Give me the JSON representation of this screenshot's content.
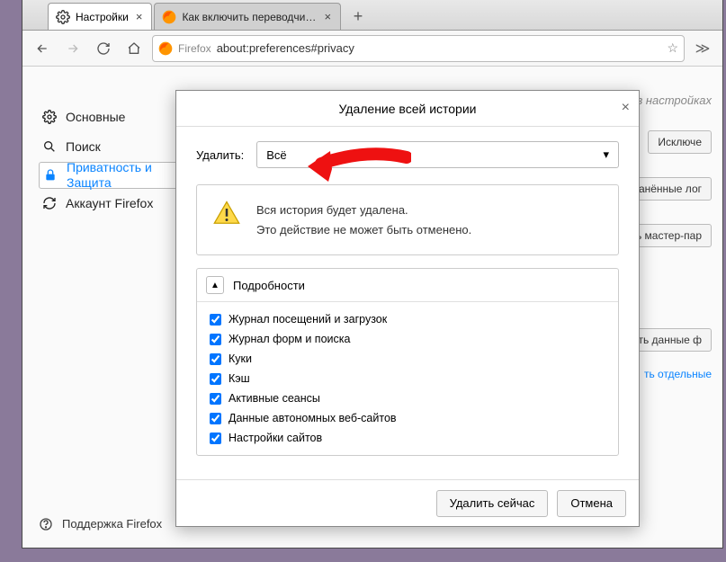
{
  "tabs": [
    {
      "label": "Настройки",
      "active": true
    },
    {
      "label": "Как включить переводчик в M",
      "active": false
    }
  ],
  "url": {
    "brand": "Firefox",
    "address": "about:preferences#privacy"
  },
  "sidebar": {
    "items": [
      {
        "label": "Основные"
      },
      {
        "label": "Поиск"
      },
      {
        "label": "Приватность и Защита"
      },
      {
        "label": "Аккаунт Firefox"
      }
    ],
    "support": "Поддержка Firefox"
  },
  "main": {
    "search_hint": "в настройках",
    "btn_exceptions": "Исключе",
    "btn_saved": "ранённые лог",
    "btn_master": "ь мастер-пар",
    "btn_savedata": "нять данные ф",
    "link_manage": "ть отдельные"
  },
  "dialog": {
    "title": "Удаление всей истории",
    "delete_label": "Удалить:",
    "delete_value": "Всё",
    "warn_line1": "Вся история будет удалена.",
    "warn_line2": "Это действие не может быть отменено.",
    "details_label": "Подробности",
    "items": [
      "Журнал посещений и загрузок",
      "Журнал форм и поиска",
      "Куки",
      "Кэш",
      "Активные сеансы",
      "Данные автономных веб-сайтов",
      "Настройки сайтов"
    ],
    "btn_ok": "Удалить сейчас",
    "btn_cancel": "Отмена"
  }
}
